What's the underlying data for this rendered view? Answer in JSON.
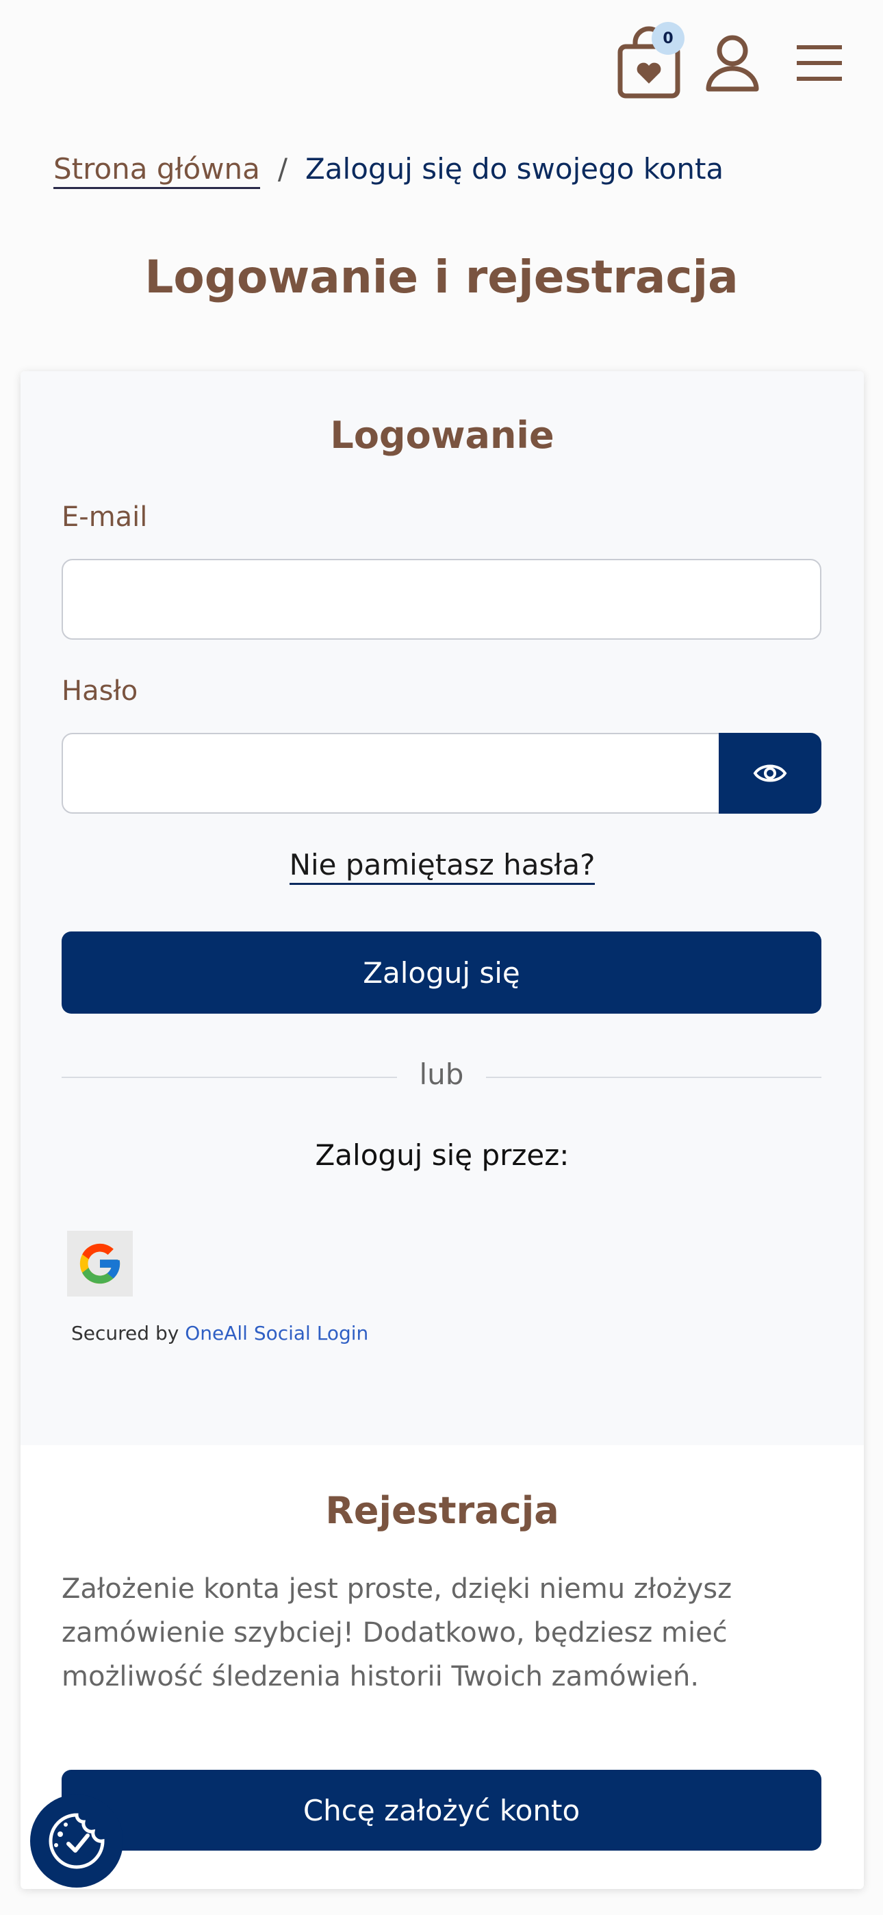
{
  "header": {
    "cart_count": "0",
    "cart_icon": "shopping-bag-heart-icon",
    "user_icon": "user-icon",
    "menu_icon": "hamburger-menu-icon"
  },
  "breadcrumb": {
    "home": "Strona główna",
    "separator": "/",
    "current": "Zaloguj się do swojego konta"
  },
  "page_title": "Logowanie i rejestracja",
  "login": {
    "title": "Logowanie",
    "email_label": "E-mail",
    "email_value": "",
    "password_label": "Hasło",
    "password_value": "",
    "show_password_icon": "eye-icon",
    "forgot_link": "Nie pamiętasz hasła?",
    "submit_label": "Zaloguj się",
    "or_text": "lub",
    "social_label": "Zaloguj się przez:",
    "google_icon": "google-icon",
    "secured_by": "Secured by",
    "secured_brand": "OneAll Social Login"
  },
  "register": {
    "title": "Rejestracja",
    "description": "Założenie konta jest proste, dzięki niemu złożysz zamówienie szybciej! Dodatkowo, będziesz mieć możliwość śledzenia historii Twoich zamówień.",
    "button_label": "Chcę założyć konto"
  },
  "cookie_icon": "cookie-consent-icon",
  "colors": {
    "brand_brown": "#7a5440",
    "brand_navy": "#032d6a",
    "badge_blue": "#c4ddf3"
  }
}
